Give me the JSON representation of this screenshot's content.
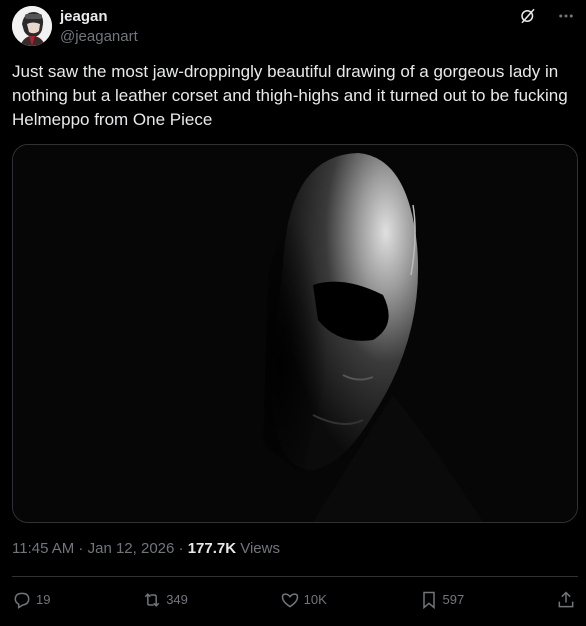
{
  "author": {
    "display_name": "jeagan",
    "handle": "@jeaganart"
  },
  "tweet": {
    "text": "Just saw the most jaw-droppingly beautiful drawing of a gorgeous lady in nothing but a leather corset and thigh-highs and it turned out to be fucking Helmeppo from One Piece"
  },
  "meta": {
    "time": "11:45 AM",
    "separator1": " · ",
    "date": "Jan 12, 2026",
    "separator2": " · ",
    "views_count": "177.7K",
    "views_label": " Views"
  },
  "actions": {
    "replies": "19",
    "reposts": "349",
    "likes": "10K",
    "bookmarks": "597"
  },
  "icons": {
    "grok": "grok-icon",
    "more": "more-icon",
    "reply": "reply-icon",
    "repost": "repost-icon",
    "like": "like-icon",
    "bookmark": "bookmark-icon",
    "share": "share-icon"
  }
}
